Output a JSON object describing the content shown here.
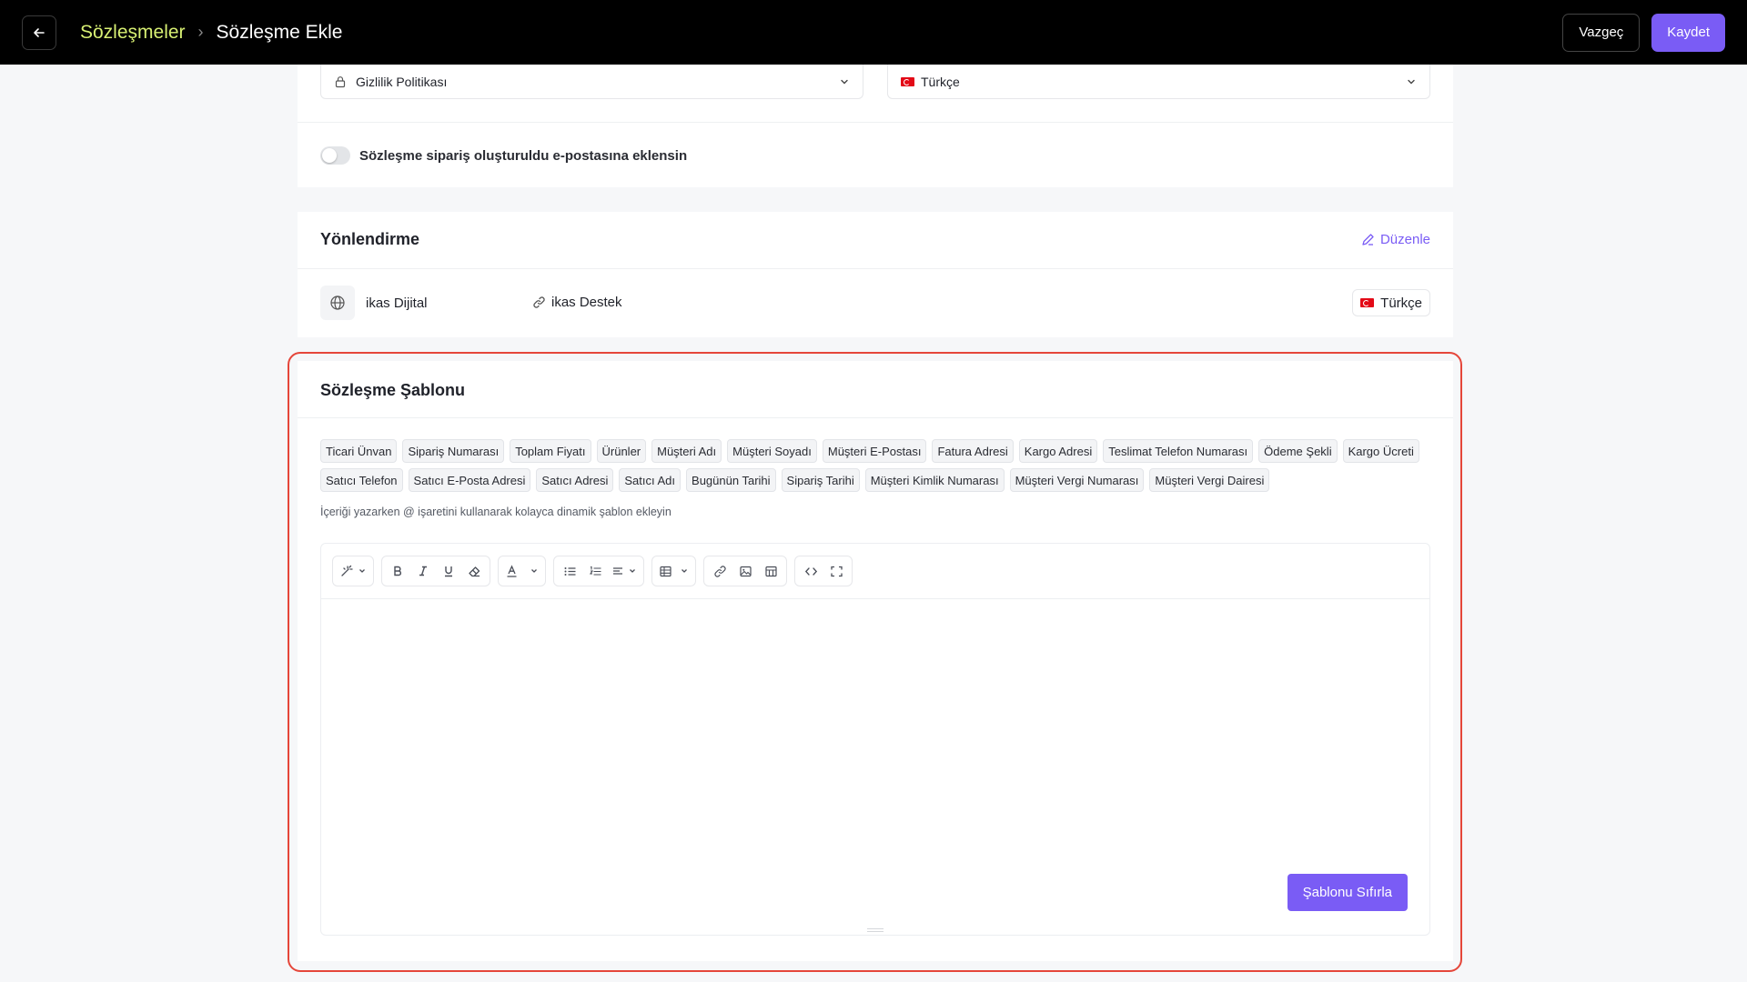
{
  "header": {
    "breadcrumb_parent": "Sözleşmeler",
    "breadcrumb_separator": "›",
    "breadcrumb_current": "Sözleşme Ekle",
    "cancel_label": "Vazgeç",
    "save_label": "Kaydet"
  },
  "settings": {
    "type_select_value": "Gizlilik Politikası",
    "language_select_value": "Türkçe",
    "email_toggle_label": "Sözleşme sipariş oluşturuldu e-postasına eklensin",
    "email_toggle_on": false
  },
  "redirect": {
    "title": "Yönlendirme",
    "edit_label": "Düzenle",
    "site_name": "ikas Dijital",
    "link_name": "ikas Destek",
    "language": "Türkçe"
  },
  "template": {
    "title": "Sözleşme Şablonu",
    "variables": [
      "Ticari Ünvan",
      "Sipariş Numarası",
      "Toplam Fiyatı",
      "Ürünler",
      "Müşteri Adı",
      "Müşteri Soyadı",
      "Müşteri E-Postası",
      "Fatura Adresi",
      "Kargo Adresi",
      "Teslimat Telefon Numarası",
      "Ödeme Şekli",
      "Kargo Ücreti",
      "Satıcı Telefon",
      "Satıcı E-Posta Adresi",
      "Satıcı Adresi",
      "Satıcı Adı",
      "Bugünün Tarihi",
      "Sipariş Tarihi",
      "Müşteri Kimlik Numarası",
      "Müşteri Vergi Numarası",
      "Müşteri Vergi Dairesi"
    ],
    "hint": "İçeriği yazarken @ işaretini kullanarak kolayca dinamik şablon ekleyin",
    "reset_label": "Şablonu Sıfırla",
    "editor_content": ""
  },
  "colors": {
    "accent": "#7a5cf5",
    "breadcrumb_parent": "#d8f073",
    "highlight_border": "#e5463a"
  }
}
